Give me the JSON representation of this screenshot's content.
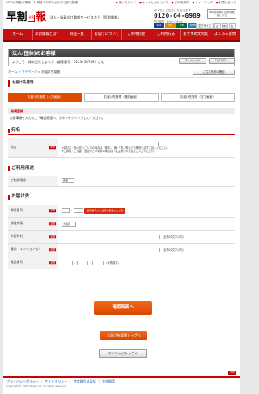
{
  "topbar": {
    "notice": "NTT/J3時金の電報｜19時までの申し込みなら即日配達",
    "links": [
      "使い方ガイド",
      "キャンセルについて",
      "ご利用規約",
      "サイトマップ",
      "お問い合わせ"
    ]
  },
  "header": {
    "logo_main": "早割",
    "logo_accent": "報",
    "logo_stamp": "電報",
    "tagline": "法人・議員向け電報サービスなら「早割電報」",
    "fax_label": "FAXでもご注文いただけます",
    "tel": "0120-64-8989",
    "hours": "受付時間：8:00〜19:00",
    "cards": [
      "VISA",
      "MC",
      "JCB",
      "AMEX"
    ],
    "fax_box": "FAX送信申し込み用紙はこちら",
    "size_label": "文字サイズ",
    "sizes": [
      "小",
      "中",
      "大"
    ]
  },
  "nav": [
    "ホーム",
    "早割電報とは？",
    "商品一覧",
    "お届けについて",
    "ご利用料金",
    "ご利用方法",
    "おすすめ文例集",
    "よくある質問"
  ],
  "member": {
    "title": "法人(団体)のお客様",
    "welcome": "ようこそ　株式会社しょうか（顧客番号：0123456789）さん",
    "mypage_btn": "マイページへ",
    "logout_btn": "ログアウト"
  },
  "breadcrumb": {
    "home": "ホーム",
    "mypage": "マイページ",
    "current": "お届け先管理"
  },
  "invoice_btn": "ご注文状況の確認",
  "page_title": "お届け先管理",
  "steps": [
    "お届け先管理（入力画面）",
    "お届け先管理（確認画面）",
    "お届け先管理（完了画面）"
  ],
  "subhead": "新規登録",
  "note_pre": "必要事項を入力の上「確認画面へ」ボタンをクリックしてください。",
  "required_label": "必須",
  "sections": {
    "name": {
      "title": "宛名",
      "label": "宛名",
      "hint1": "※会社名・個人名をご入力の場合は「御中」「様」「殿」等などの敬称を必ずご記入ください。",
      "hint2": "※ご葬儀・ご法要・回送などの弔事の場合は「喪主様」の氏名をご入力ください。"
    },
    "usage": {
      "title": "ご利用用途",
      "label": "ご利用用途",
      "value": "慶事"
    },
    "address": {
      "title": "お届け先",
      "zip_label": "郵便番号",
      "zip_btn": "郵便番号から住所を自動入力する",
      "pref_label": "都道府県",
      "pref_value": "大阪府",
      "city_label": "市区町村",
      "city_hint": "（全角50文字以内）",
      "bldg_label": "番地（マンション名）",
      "bldg_hint": "（全角50文字以内）",
      "tel_label": "電話番号",
      "tel_hint": "（半角数字）"
    }
  },
  "confirm_btn": "確認画面へ",
  "top_btn": "お届け先管理トップへ",
  "mypage_top_btn": "マイページトップへ",
  "pagetop": "TOP",
  "footer": {
    "links": [
      "プライバシーポリシー",
      "サイトポリシー",
      "特定取引法表記",
      "会社概要"
    ],
    "copy": "Copyright © 2008 Shokai Inc. All rights reserved."
  }
}
